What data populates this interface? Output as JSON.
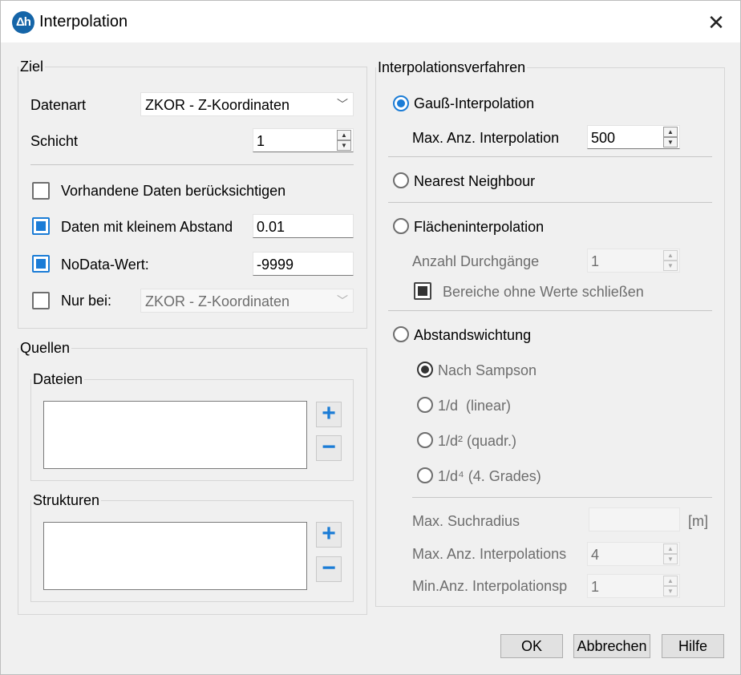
{
  "window": {
    "title": "Interpolation",
    "app_icon_text": "Δh",
    "close_glyph": "✕"
  },
  "ziel": {
    "title": "Ziel",
    "datenart_label": "Datenart",
    "datenart_value": "ZKOR - Z-Koordinaten",
    "schicht_label": "Schicht",
    "schicht_value": "1",
    "vorhandene_label": "Vorhandene Daten berücksichtigen",
    "vorhandene_checked": false,
    "kleinem_label": "Daten mit kleinem Abstand",
    "kleinem_checked": true,
    "kleinem_value": "0.01",
    "nodata_label": "NoData-Wert:",
    "nodata_checked": true,
    "nodata_value": "-9999",
    "nurbei_label": "Nur bei:",
    "nurbei_checked": false,
    "nurbei_value": "ZKOR - Z-Koordinaten"
  },
  "quellen": {
    "title": "Quellen",
    "dateien_title": "Dateien",
    "strukturen_title": "Strukturen",
    "add_glyph": "+",
    "remove_glyph": "−"
  },
  "verfahren": {
    "title": "Interpolationsverfahren",
    "gauss_label": "Gauß-Interpolation",
    "gauss_max_label": "Max. Anz. Interpolation",
    "gauss_max_value": "500",
    "nearest_label": "Nearest Neighbour",
    "flaechen_label": "Flächeninterpolation",
    "durchgaenge_label": "Anzahl Durchgänge",
    "durchgaenge_value": "1",
    "bereiche_label": "Bereiche ohne Werte schließen",
    "abstand_label": "Abstandswichtung",
    "sampson_label": "Nach Sampson",
    "linear_label": "1/d  (linear)",
    "quadr_label": "1/d² (quadr.)",
    "grades_label": "1/d⁴ (4. Grades)",
    "suchradius_label": "Max. Suchradius",
    "suchradius_value": "",
    "suchradius_unit": "[m]",
    "max_anz_label": "Max. Anz. Interpolations",
    "max_anz_value": "4",
    "min_anz_label": "Min.Anz. Interpolationsp",
    "min_anz_value": "1"
  },
  "buttons": {
    "ok": "OK",
    "abbrechen": "Abbrechen",
    "hilfe": "Hilfe"
  }
}
